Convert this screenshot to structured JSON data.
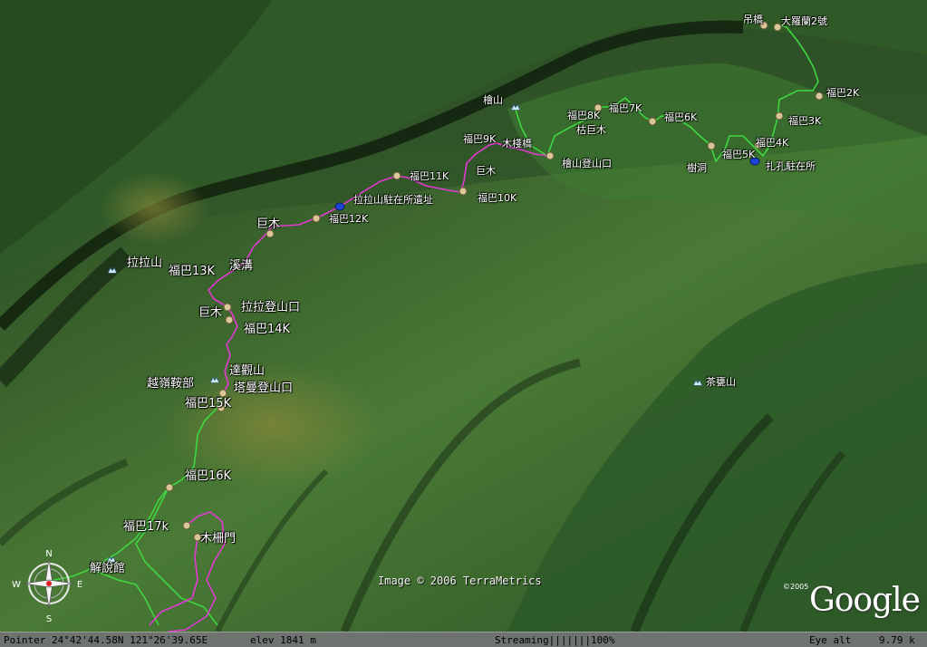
{
  "map": {
    "labels": {
      "diaoqiao": "吊橋",
      "dafulan": "大羅蘭2號",
      "fuba2k": "福巴2K",
      "fuba3k": "福巴3K",
      "fuba4k": "福巴4K",
      "fuba5k": "福巴5K",
      "zhakong": "扎孔駐在所",
      "shudong": "樹洞",
      "fuba6k": "福巴6K",
      "fuba7k": "福巴7K",
      "fuba8k": "福巴8K",
      "kujumu": "枯巨木",
      "huishan": "檜山",
      "huishan_trailhead": "檜山登山口",
      "muzhan": "木棧橋",
      "fuba9k": "福巴9K",
      "jumu1": "巨木",
      "fuba10k": "福巴10K",
      "fuba11k": "福巴11K",
      "lala_station": "拉拉山駐在所遺址",
      "fuba12k": "福巴12K",
      "jumu2": "巨木",
      "lalashan": "拉拉山",
      "fuba13k": "福巴13K",
      "xigou": "溪溝",
      "jumu3": "巨木",
      "lala_trailhead": "拉拉登山口",
      "fuba14k": "福巴14K",
      "daguan": "達觀山",
      "yueling": "越嶺鞍部",
      "taman": "塔曼登山口",
      "fuba15k": "福巴15K",
      "fuba16k": "福巴16K",
      "fuba17k": "福巴17k",
      "muzhamen": "木柵門",
      "jieshuoguan": "解說館",
      "chaweng": "茶甕山"
    },
    "credit": "Image © 2006 TerraMetrics",
    "logo": "Google",
    "logo_year": "©2005"
  },
  "compass": {
    "n": "N",
    "s": "S",
    "e": "E",
    "w": "W"
  },
  "status": {
    "pointer": "Pointer 24°42'44.58N  121°26'39.65E",
    "elev": "elev 1841 m",
    "streaming": "Streaming|||||||100%",
    "eye_alt": "Eye alt",
    "eye_alt_value": "9.79 k"
  },
  "colors": {
    "trail_green": "#3fd640",
    "trail_magenta": "#e23ad2",
    "ridge": "#0f1e0d",
    "status_bg": "#6f7370"
  }
}
